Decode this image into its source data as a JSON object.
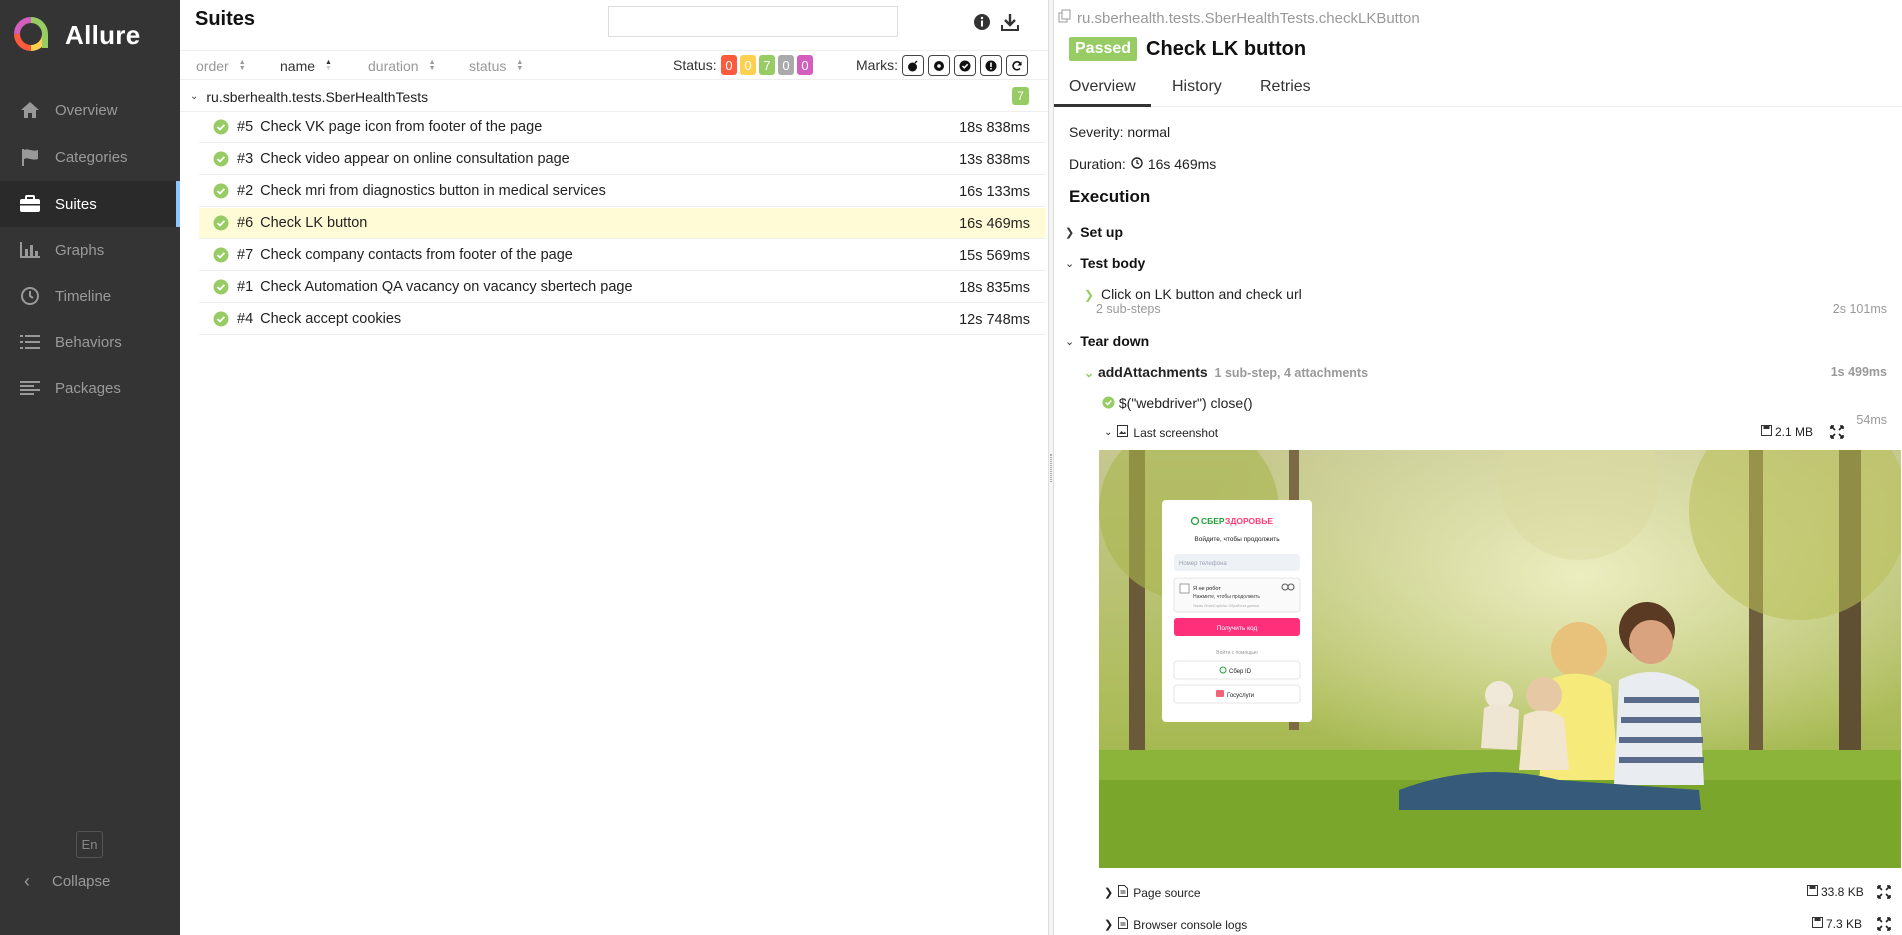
{
  "sidebar": {
    "brand": "Allure",
    "items": [
      {
        "label": "Overview",
        "icon": "home-icon"
      },
      {
        "label": "Categories",
        "icon": "flag-icon"
      },
      {
        "label": "Suites",
        "icon": "briefcase-icon",
        "active": true
      },
      {
        "label": "Graphs",
        "icon": "bar-chart-icon"
      },
      {
        "label": "Timeline",
        "icon": "clock-icon"
      },
      {
        "label": "Behaviors",
        "icon": "list-icon"
      },
      {
        "label": "Packages",
        "icon": "align-left-icon"
      }
    ],
    "language": "En",
    "collapse_label": "Collapse"
  },
  "suites": {
    "title": "Suites",
    "search_value": "",
    "sort_columns": [
      "order",
      "name",
      "duration",
      "status"
    ],
    "active_sort": "name",
    "status_label": "Status:",
    "status_counts": [
      {
        "value": "0",
        "color": "#fd5a3e"
      },
      {
        "value": "0",
        "color": "#ffd050"
      },
      {
        "value": "7",
        "color": "#97cc64"
      },
      {
        "value": "0",
        "color": "#aaaaaa"
      },
      {
        "value": "0",
        "color": "#d35ebe"
      }
    ],
    "marks_label": "Marks:",
    "marks": [
      "bomb-icon",
      "gear-icon",
      "shield-check-icon",
      "exclamation-icon",
      "refresh-icon"
    ],
    "group": {
      "name": "ru.sberhealth.tests.SberHealthTests",
      "count": "7"
    },
    "tests": [
      {
        "num": "#5",
        "name": "Check VK page icon from footer of the page",
        "duration": "18s 838ms"
      },
      {
        "num": "#3",
        "name": "Check video appear on online consultation page",
        "duration": "13s 838ms"
      },
      {
        "num": "#2",
        "name": "Check mri from diagnostics button in medical services",
        "duration": "16s 133ms"
      },
      {
        "num": "#6",
        "name": "Check LK button",
        "duration": "16s 469ms",
        "selected": true
      },
      {
        "num": "#7",
        "name": "Check company contacts from footer of the page",
        "duration": "15s 569ms"
      },
      {
        "num": "#1",
        "name": "Check Automation QA vacancy on vacancy sbertech page",
        "duration": "18s 835ms"
      },
      {
        "num": "#4",
        "name": "Check accept cookies",
        "duration": "12s 748ms"
      }
    ]
  },
  "detail": {
    "breadcrumb": "ru.sberhealth.tests.SberHealthTests.checkLKButton",
    "status": "Passed",
    "title": "Check LK button",
    "tabs": [
      "Overview",
      "History",
      "Retries"
    ],
    "severity": "Severity: normal",
    "duration_label": "Duration:",
    "duration_value": "16s 469ms",
    "execution_title": "Execution",
    "setup_label": "Set up",
    "test_body_label": "Test body",
    "step1": {
      "name": "Click on LK button and check url",
      "sub": "2 sub-steps",
      "duration": "2s 101ms"
    },
    "teardown_label": "Tear down",
    "add_attachments": {
      "name": "addAttachments",
      "sub": "1 sub-step, 4 attachments",
      "duration": "1s 499ms"
    },
    "close_step": {
      "name": "$(\"webdriver\") close()",
      "duration": "54ms"
    },
    "attachments": [
      {
        "name": "Last screenshot",
        "size": "2.1 MB"
      },
      {
        "name": "Page source",
        "size": "33.8 KB"
      },
      {
        "name": "Browser console logs",
        "size": "7.3 KB"
      }
    ]
  },
  "screenshot": {
    "brand_left": "СБЕР",
    "brand_right": "ЗДОРОВЬЕ",
    "subtitle": "Войдите, чтобы продолжить",
    "phone_placeholder": "Номер телефона",
    "captcha_title": "Я не робот",
    "captcha_hint": "Нажмите, чтобы продолжить",
    "captcha_small": "Умная SmartCaptcha. Обработка данных",
    "get_code": "Получить код",
    "login_with": "Войти с помощью",
    "sber_id": "Сбер ID",
    "gosuslugi": "Госуслуги"
  }
}
